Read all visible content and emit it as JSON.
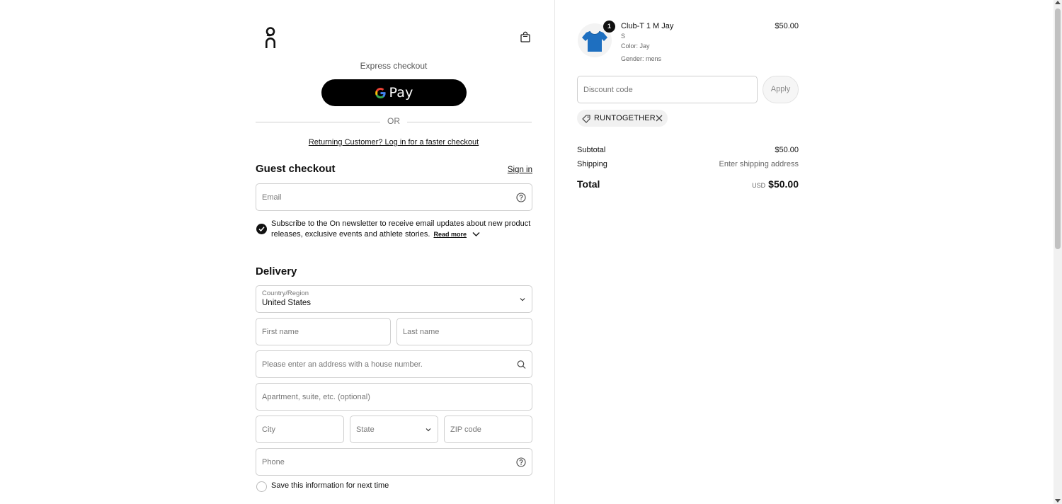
{
  "header": {
    "logo_icon": "on-logo-icon",
    "cart_icon": "shopping-bag-icon"
  },
  "express": {
    "label": "Express checkout",
    "gpay_label": "Pay",
    "or_label": "OR",
    "returning_link": "Returning Customer? Log in for a faster checkout"
  },
  "guest": {
    "title": "Guest checkout",
    "sign_in": "Sign in",
    "email_placeholder": "Email",
    "subscribe_text": "Subscribe to the On newsletter to receive email updates about new product releases, exclusive events and athlete stories.",
    "read_more": "Read more",
    "subscribe_checked": true
  },
  "delivery": {
    "title": "Delivery",
    "country_label": "Country/Region",
    "country_value": "United States",
    "first_name_placeholder": "First name",
    "last_name_placeholder": "Last name",
    "address_placeholder": "Please enter an address with a house number.",
    "apartment_placeholder": "Apartment, suite, etc. (optional)",
    "city_placeholder": "City",
    "state_placeholder": "State",
    "zip_placeholder": "ZIP code",
    "phone_placeholder": "Phone",
    "save_info": "Save this information for next time",
    "save_checked": false
  },
  "cart": {
    "item": {
      "quantity": "1",
      "name": "Club-T 1 M Jay",
      "size": "S",
      "color": "Color: Jay",
      "gender": "Gender: mens",
      "price": "$50.00",
      "shirt_color": "#1e6fc0"
    },
    "discount_placeholder": "Discount code",
    "apply_label": "Apply",
    "promo_code": "RUNTOGETHER",
    "subtotal_label": "Subtotal",
    "subtotal_value": "$50.00",
    "shipping_label": "Shipping",
    "shipping_value": "Enter shipping address",
    "total_label": "Total",
    "total_currency": "USD",
    "total_value": "$50.00"
  }
}
